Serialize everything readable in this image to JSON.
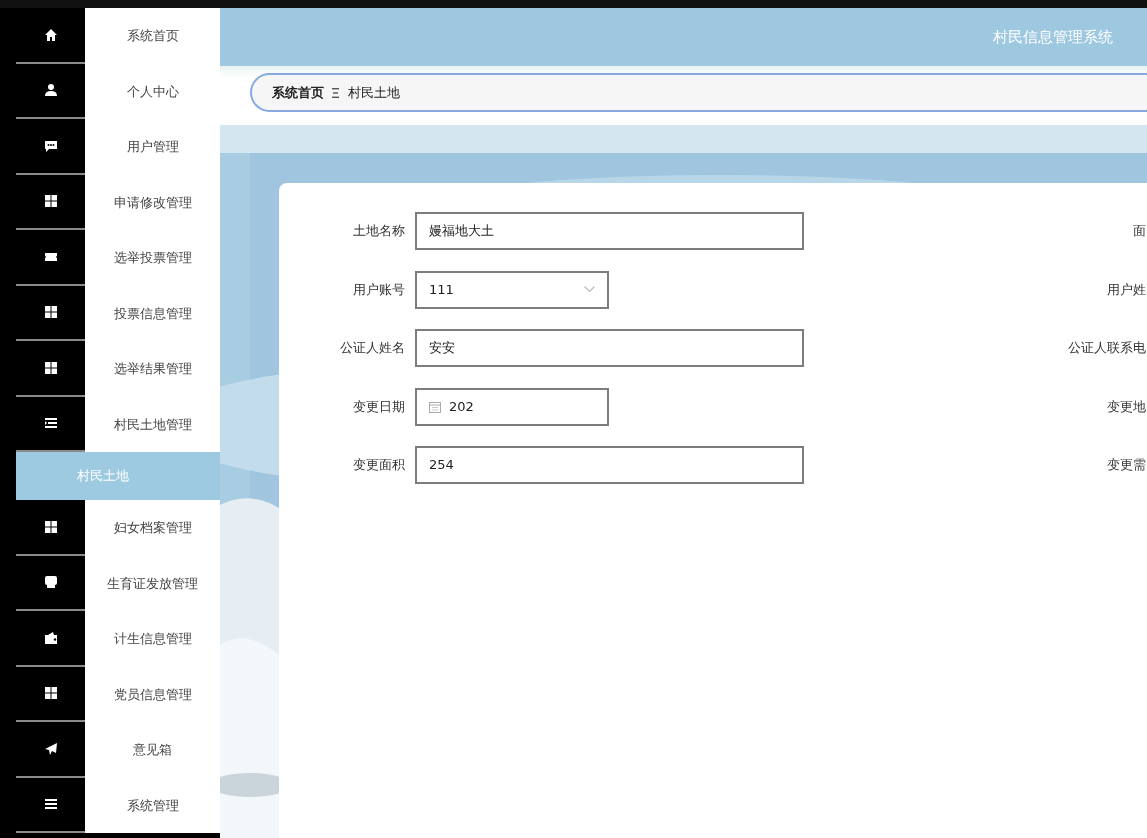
{
  "sidebar": {
    "items": [
      {
        "label": "系统首页",
        "selected": false
      },
      {
        "label": "个人中心",
        "selected": false
      },
      {
        "label": "用户管理",
        "selected": false
      },
      {
        "label": "申请修改管理",
        "selected": false
      },
      {
        "label": "选举投票管理",
        "selected": false
      },
      {
        "label": "投票信息管理",
        "selected": false
      },
      {
        "label": "选举结果管理",
        "selected": false
      },
      {
        "label": "村民土地管理",
        "selected": false,
        "expanded": true,
        "children": [
          {
            "label": "村民土地",
            "selected": true
          }
        ]
      },
      {
        "label": "妇女档案管理",
        "selected": false
      },
      {
        "label": "生育证发放管理",
        "selected": false
      },
      {
        "label": "计生信息管理",
        "selected": false
      },
      {
        "label": "党员信息管理",
        "selected": false
      },
      {
        "label": "意见箱",
        "selected": false
      },
      {
        "label": "系统管理",
        "selected": false
      }
    ]
  },
  "header": {
    "title": "村民信息管理系统"
  },
  "breadcrumb": [
    {
      "label": "系统首页"
    },
    {
      "label": "村民土地"
    }
  ],
  "form": {
    "rows": [
      {
        "left": {
          "label": "土地名称",
          "kind": "text",
          "value": "嫚福地大土"
        },
        "right": {
          "label": "面"
        }
      },
      {
        "left": {
          "label": "用户账号",
          "kind": "select",
          "value": "111"
        },
        "right": {
          "label": "用户姓"
        }
      },
      {
        "left": {
          "label": "公证人姓名",
          "kind": "text",
          "value": "安安"
        },
        "right": {
          "label": "公证人联系电"
        }
      },
      {
        "left": {
          "label": "变更日期",
          "kind": "date",
          "value": "202"
        },
        "right": {
          "label": "变更地"
        }
      },
      {
        "left": {
          "label": "变更面积",
          "kind": "text",
          "value": "254"
        },
        "right": {
          "label": "变更需"
        }
      }
    ]
  }
}
